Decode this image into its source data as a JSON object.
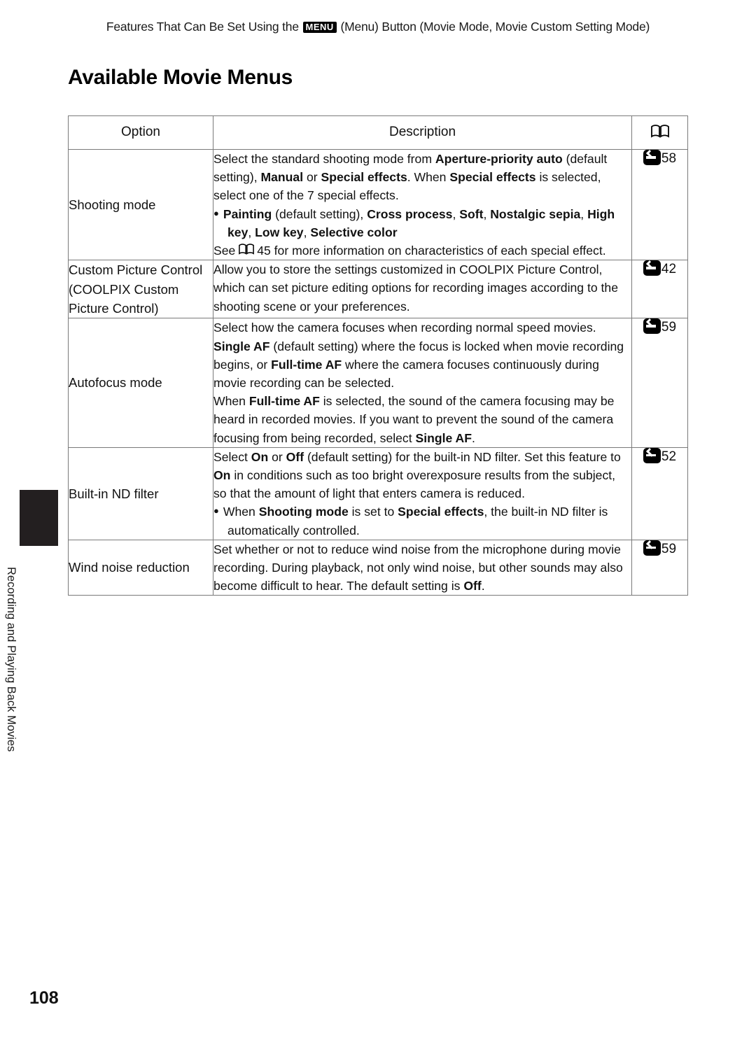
{
  "header": {
    "text_before": "Features That Can Be Set Using the ",
    "menu_glyph": "MENU",
    "text_after": " (Menu) Button (Movie Mode, Movie Custom Setting Mode)"
  },
  "title": "Available Movie Menus",
  "side_tab_label": "Recording and Playing Back Movies",
  "page_number": "108",
  "table": {
    "columns": [
      "Option",
      "Description",
      "book-icon"
    ],
    "rows": [
      {
        "option": "Shooting mode",
        "ref": "58",
        "description_lines": [
          {
            "type": "text",
            "parts": [
              {
                "t": "Select the standard shooting mode from ",
                "b": false
              },
              {
                "t": "Aperture-priority auto",
                "b": true
              },
              {
                "t": " (default setting), ",
                "b": false
              },
              {
                "t": "Manual",
                "b": true
              },
              {
                "t": " or ",
                "b": false
              },
              {
                "t": "Special effects",
                "b": true
              },
              {
                "t": ". When ",
                "b": false
              },
              {
                "t": "Special effects",
                "b": true
              },
              {
                "t": " is selected, select one of the 7 special effects.",
                "b": false
              }
            ]
          },
          {
            "type": "bullet",
            "parts": [
              {
                "t": "Painting",
                "b": true
              },
              {
                "t": " (default setting), ",
                "b": false
              },
              {
                "t": "Cross process",
                "b": true
              },
              {
                "t": ", ",
                "b": false
              },
              {
                "t": "Soft",
                "b": true
              },
              {
                "t": ", ",
                "b": false
              },
              {
                "t": "Nostalgic sepia",
                "b": true
              },
              {
                "t": ", ",
                "b": false
              },
              {
                "t": "High key",
                "b": true
              },
              {
                "t": ", ",
                "b": false
              },
              {
                "t": "Low key",
                "b": true
              },
              {
                "t": ", ",
                "b": false
              },
              {
                "t": "Selective color",
                "b": true
              }
            ]
          },
          {
            "type": "text",
            "parts": [
              {
                "t": "See ",
                "b": false
              },
              {
                "t": "[book]45",
                "b": false
              },
              {
                "t": " for more information on characteristics of each special effect.",
                "b": false
              }
            ]
          }
        ]
      },
      {
        "option": "Custom Picture Control (COOLPIX Custom Picture Control)",
        "ref": "42",
        "description_lines": [
          {
            "type": "text",
            "parts": [
              {
                "t": "Allow you to store the settings customized in COOLPIX Picture Control, which can set picture editing options for recording images according to the shooting scene or your preferences.",
                "b": false
              }
            ]
          }
        ]
      },
      {
        "option": "Autofocus mode",
        "ref": "59",
        "description_lines": [
          {
            "type": "text",
            "parts": [
              {
                "t": "Select how the camera focuses when recording normal speed movies.",
                "b": false
              }
            ]
          },
          {
            "type": "text",
            "parts": [
              {
                "t": "Single AF",
                "b": true
              },
              {
                "t": " (default setting) where the focus is locked when movie recording begins, or ",
                "b": false
              },
              {
                "t": "Full-time AF",
                "b": true
              },
              {
                "t": " where the camera focuses continuously during movie recording can be selected.",
                "b": false
              }
            ]
          },
          {
            "type": "text",
            "parts": [
              {
                "t": "When ",
                "b": false
              },
              {
                "t": "Full-time AF",
                "b": true
              },
              {
                "t": " is selected, the sound of the camera focusing may be heard in recorded movies. If you want to prevent the sound of the camera focusing from being recorded, select ",
                "b": false
              },
              {
                "t": "Single AF",
                "b": true
              },
              {
                "t": ".",
                "b": false
              }
            ]
          }
        ]
      },
      {
        "option": "Built-in ND filter",
        "ref": "52",
        "description_lines": [
          {
            "type": "text",
            "parts": [
              {
                "t": "Select ",
                "b": false
              },
              {
                "t": "On",
                "b": true
              },
              {
                "t": " or ",
                "b": false
              },
              {
                "t": "Off",
                "b": true
              },
              {
                "t": " (default setting) for the built-in ND filter. Set this feature to ",
                "b": false
              },
              {
                "t": "On",
                "b": true
              },
              {
                "t": " in conditions such as too bright overexposure results from the subject, so that the amount of light that enters camera is reduced.",
                "b": false
              }
            ]
          },
          {
            "type": "bullet",
            "parts": [
              {
                "t": "When ",
                "b": false
              },
              {
                "t": "Shooting mode",
                "b": true
              },
              {
                "t": " is set to ",
                "b": false
              },
              {
                "t": "Special effects",
                "b": true
              },
              {
                "t": ", the built-in ND filter is automatically controlled.",
                "b": false
              }
            ]
          }
        ]
      },
      {
        "option": "Wind noise reduction",
        "ref": "59",
        "description_lines": [
          {
            "type": "text",
            "parts": [
              {
                "t": "Set whether or not to reduce wind noise from the microphone during movie recording. During playback, not only wind noise, but other sounds may also become difficult to hear. The default setting is ",
                "b": false
              },
              {
                "t": "Off",
                "b": true
              },
              {
                "t": ".",
                "b": false
              }
            ]
          }
        ]
      }
    ]
  }
}
